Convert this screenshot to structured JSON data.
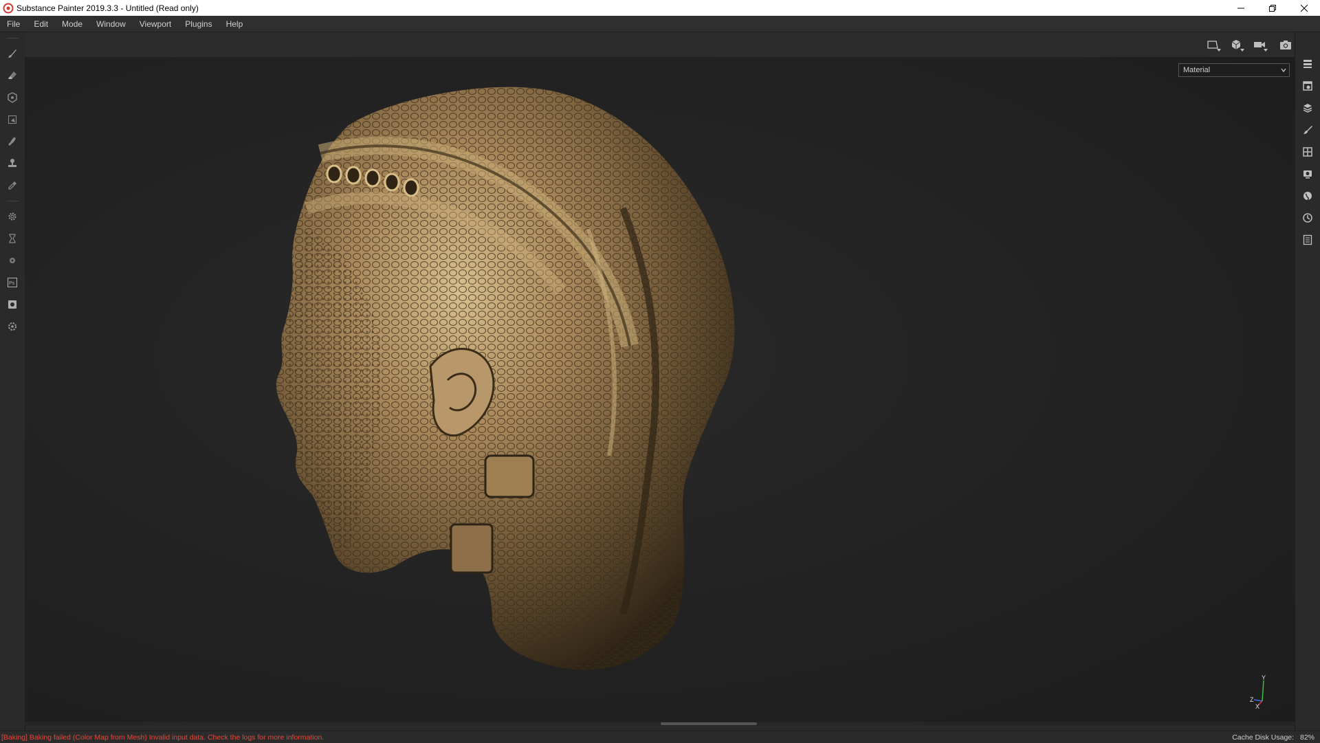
{
  "window": {
    "title": "Substance Painter 2019.3.3 - Untitled (Read only)"
  },
  "menu": [
    "File",
    "Edit",
    "Mode",
    "Window",
    "Viewport",
    "Plugins",
    "Help"
  ],
  "viewport": {
    "mode_select": "Material",
    "gizmo_axes": {
      "y": "Y",
      "z": "Z",
      "x": "X"
    }
  },
  "status": {
    "error": "[Baking] Baking failed (Color Map from Mesh) Invalid input data. Check the logs for more information.",
    "cache_label": "Cache Disk Usage:",
    "cache_value": "82%"
  },
  "colors": {
    "error": "#e04a3a",
    "model_bronze": "#a8875a"
  }
}
